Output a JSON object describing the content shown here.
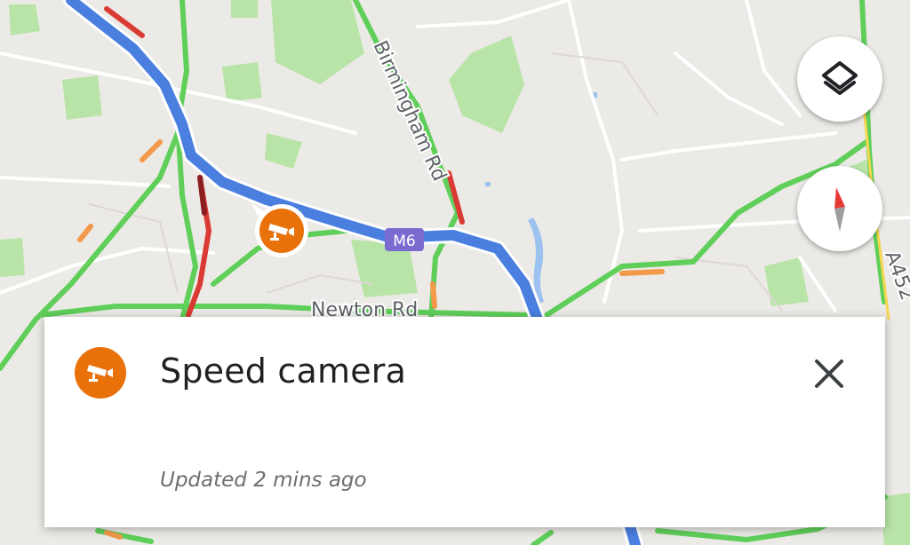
{
  "map": {
    "roads": {
      "birmingham_rd": "Birmingham Rd",
      "newton_rd": "Newton Rd",
      "a452": "A452",
      "m6_shield": "M6"
    },
    "route_color": "#4a7fe0",
    "traffic_colors": {
      "free": "#5fcf5a",
      "slow": "#f2994a",
      "heavy": "#d93a33",
      "jam": "#8b1f1f"
    }
  },
  "controls": {
    "layers_icon": "layers-icon",
    "compass_icon": "compass-icon"
  },
  "alert_marker": {
    "icon": "speed-camera-icon",
    "color": "#e8710a"
  },
  "card": {
    "icon": "speed-camera-icon",
    "title": "Speed camera",
    "subtitle": "Updated 2 mins ago",
    "close_icon": "close-icon"
  }
}
